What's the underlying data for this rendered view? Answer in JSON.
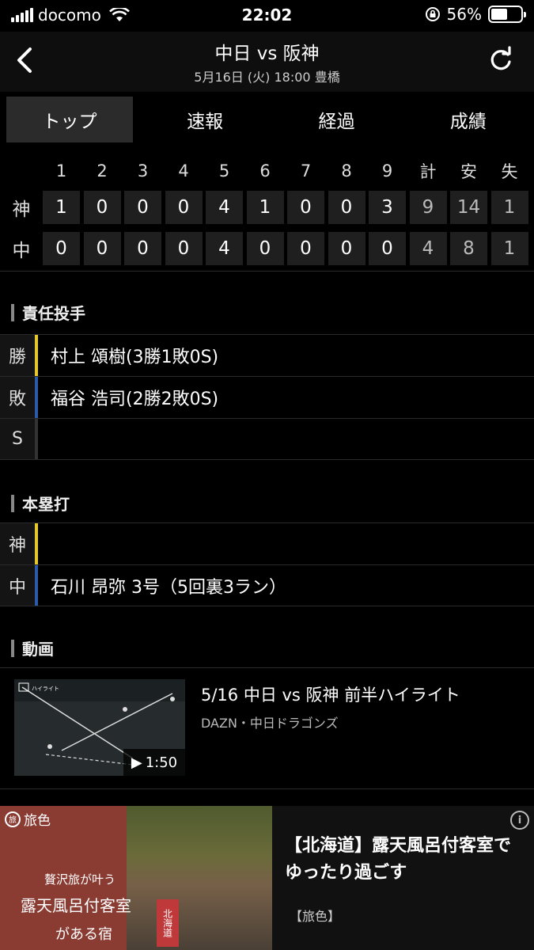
{
  "status_bar": {
    "carrier": "docomo",
    "time": "22:02",
    "battery": "56%",
    "battery_level": 0.56
  },
  "header": {
    "title": "中日 vs 阪神",
    "subtitle": "5月16日 (火) 18:00 豊橋"
  },
  "tabs": [
    {
      "label": "トップ",
      "active": true
    },
    {
      "label": "速報"
    },
    {
      "label": "経過"
    },
    {
      "label": "成績"
    }
  ],
  "scoreboard": {
    "columns": [
      "1",
      "2",
      "3",
      "4",
      "5",
      "6",
      "7",
      "8",
      "9",
      "計",
      "安",
      "失"
    ],
    "rows": [
      {
        "team": "神",
        "values": [
          "1",
          "0",
          "0",
          "0",
          "4",
          "1",
          "0",
          "0",
          "3",
          "9",
          "14",
          "1"
        ]
      },
      {
        "team": "中",
        "values": [
          "0",
          "0",
          "0",
          "0",
          "4",
          "0",
          "0",
          "0",
          "0",
          "4",
          "8",
          "1"
        ]
      }
    ]
  },
  "pitchers": {
    "title": "責任投手",
    "win": {
      "tag": "勝",
      "text": "村上 頌樹(3勝1敗0S)",
      "color": "#e5c72c"
    },
    "loss": {
      "tag": "敗",
      "text": "福谷 浩司(2勝2敗0S)",
      "color": "#2a5aa8"
    },
    "save": {
      "tag": "S",
      "text": ""
    }
  },
  "homeruns": {
    "title": "本塁打",
    "tigers": {
      "tag": "神",
      "text": "",
      "color": "#e5c72c"
    },
    "dragons": {
      "tag": "中",
      "text": "石川 昂弥 3号（5回裏3ラン）",
      "color": "#2a5aa8"
    }
  },
  "video": {
    "title": "動画",
    "item_title": "5/16 中日 vs 阪神  前半ハイライト",
    "item_source": "DAZN・中日ドラゴンズ",
    "duration": "1:50"
  },
  "ad": {
    "brand": "旅色",
    "copy1": "贅沢旅が叶う",
    "copy2": "露天風呂付客室",
    "copy3": "がある宿",
    "badge": "北海道",
    "headline": "【北海道】露天風呂付客室でゆったり過ごす",
    "source": "【旅色】",
    "info_icon": "i"
  }
}
